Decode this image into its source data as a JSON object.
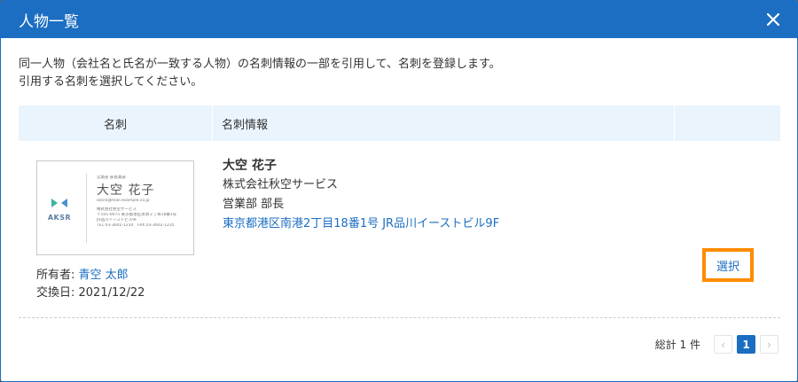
{
  "dialog": {
    "title": "人物一覧",
    "description_line1": "同一人物（会社名と氏名が一致する人物）の名刺情報の一部を引用して、名刺を登録します。",
    "description_line2": "引用する名刺を選択してください。"
  },
  "table": {
    "headers": [
      "名刺",
      "名刺情報",
      ""
    ],
    "rows": [
      {
        "card_image": {
          "logo_text": "AKSR",
          "dept": "営業部 部長業部",
          "name": "大空 花子",
          "email": "ozora@mail.example.co.jp",
          "company": "株式会社秋空サービス",
          "address": "〒105-0075 東京都港区南港２丁目18番1号",
          "building": "JR品川イーストビル9F",
          "phone": "TEL 03-3602-1234　FAX 03-3602-1235"
        },
        "owner_label": "所有者: ",
        "owner_name": "青空 太郎",
        "exchange_label": "交換日: ",
        "exchange_date": "2021/12/22",
        "name": "大空 花子",
        "company": "株式会社秋空サービス",
        "position": "営業部 部長",
        "address": "東京都港区南港2丁目18番1号 JR品川イーストビル9F",
        "select_label": "選択"
      }
    ]
  },
  "pagination": {
    "total_text": "総計 1 件",
    "prev": "‹",
    "current": "1",
    "next": "›"
  },
  "colors": {
    "primary": "#1b6ec2",
    "highlight": "#ff8b00",
    "header_bg": "#eaf4fd"
  }
}
